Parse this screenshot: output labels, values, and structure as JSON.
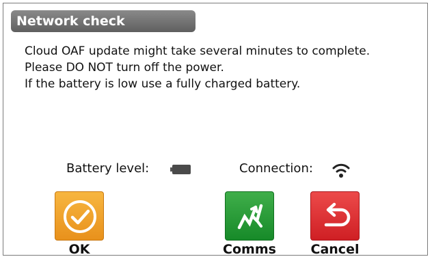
{
  "dialog": {
    "title": "Network check",
    "message_lines": [
      "Cloud OAF update might take several minutes to complete.",
      "Please DO NOT turn off the power.",
      "If the battery is low use a fully charged battery."
    ]
  },
  "status": {
    "battery_label": "Battery level:",
    "battery_icon": "battery-icon",
    "connection_label": "Connection:",
    "connection_icon": "wifi-icon"
  },
  "buttons": {
    "ok": {
      "label": "OK",
      "icon": "checkmark-circle-icon",
      "color": "#f0a12e"
    },
    "comms": {
      "label": "Comms",
      "icon": "signal-zigzag-icon",
      "color": "#22963a"
    },
    "cancel": {
      "label": "Cancel",
      "icon": "return-arrow-icon",
      "color": "#de2e31"
    }
  }
}
